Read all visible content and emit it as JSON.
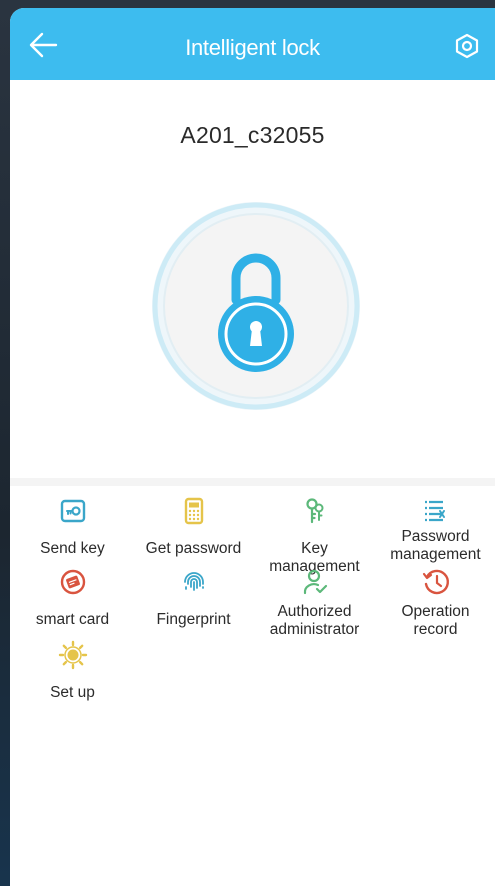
{
  "header": {
    "back_icon": "arrow-left-icon",
    "title": "Intelligent lock",
    "settings_icon": "hexagon-settings-icon"
  },
  "device": {
    "name": "A201_c32055",
    "lock_icon": "padlock-icon",
    "lock_color": "#2fb0e6"
  },
  "menu": {
    "items": [
      {
        "label": "Send key",
        "icon": "send-key-icon",
        "color": "#3aa6c9"
      },
      {
        "label": "Get password",
        "icon": "keypad-icon",
        "color": "#e5c44a"
      },
      {
        "label": "Key management",
        "icon": "keys-icon",
        "color": "#5cb87a"
      },
      {
        "label": "Password\nmanagement",
        "icon": "list-x-icon",
        "color": "#3aa6c9"
      },
      {
        "label": "smart card",
        "icon": "smart-card-icon",
        "color": "#d9543f"
      },
      {
        "label": "Fingerprint",
        "icon": "fingerprint-icon",
        "color": "#3aa6c9"
      },
      {
        "label": "Authorized\nadministrator",
        "icon": "user-check-icon",
        "color": "#5cb87a"
      },
      {
        "label": "Operation\nrecord",
        "icon": "history-icon",
        "color": "#d9543f"
      },
      {
        "label": "Set up",
        "icon": "sun-gear-icon",
        "color": "#e5c44a"
      }
    ]
  }
}
